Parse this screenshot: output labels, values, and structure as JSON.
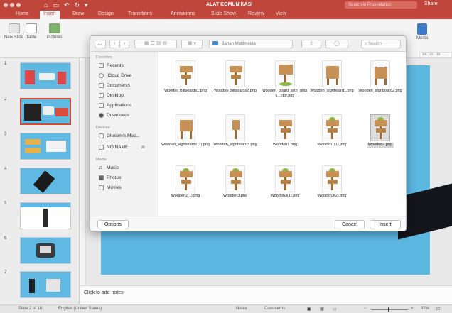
{
  "title_bar": {
    "app_title": "ALAT KOMUNIKASI",
    "search_placeholder": "Search in Presentation",
    "share_label": "Share",
    "quick_access": [
      "⌂",
      "▭",
      "↶",
      "↻",
      "▾"
    ]
  },
  "ribbon_tabs": [
    "Home",
    "Insert",
    "Draw",
    "Design",
    "Transitions",
    "Animations",
    "Slide Show",
    "Review",
    "View"
  ],
  "active_tab": "Insert",
  "ribbon": {
    "new_slide_label": "New Slide",
    "table_label": "Table",
    "pictures_label": "Pictures",
    "media_label": "Media"
  },
  "thumbnails": {
    "numbers": [
      "1",
      "2",
      "3",
      "4",
      "5",
      "6",
      "7"
    ],
    "selected": "2"
  },
  "notes_placeholder": "Click to add notes",
  "status_bar": {
    "slide_info": "Slide 2 of 16",
    "language": "English (United States)",
    "notes_label": "Notes",
    "comments_label": "Comments",
    "zoom": "82%"
  },
  "dialog": {
    "location": "Bahan Multimedia",
    "search_placeholder": "Search",
    "favorites_header": "Favorites",
    "favorites": [
      "Recents",
      "iCloud Drive",
      "Documents",
      "Desktop",
      "Applications",
      "Downloads"
    ],
    "devices_header": "Devices",
    "devices": [
      "Ghulam's Mac...",
      "NO NAME"
    ],
    "media_header": "Media",
    "media": [
      "Music",
      "Photos",
      "Movies"
    ],
    "files": [
      "Wooden Billboards1.png",
      "Wooden Billboards2.png",
      "wooden_board_with_grass...ctor.png",
      "Wooden_signboard1.png",
      "Wooden_signboard2.png",
      "Wooden_signboard2(1).png",
      "Wooden_signboard3.png",
      "Wooden1.png",
      "Wooden1(1).png",
      "Wooden2.png",
      "Wooden2(1).png",
      "Wooden3.png",
      "Wooden3(1).png",
      "Wooden3(2).png"
    ],
    "selected_file": "Wooden2.png",
    "options_label": "Options",
    "cancel_label": "Cancel",
    "insert_label": "Insert"
  },
  "colors": {
    "accent": "#c0453a",
    "slide_bg": "#5cb7e1",
    "selection": "#d04a3c"
  }
}
